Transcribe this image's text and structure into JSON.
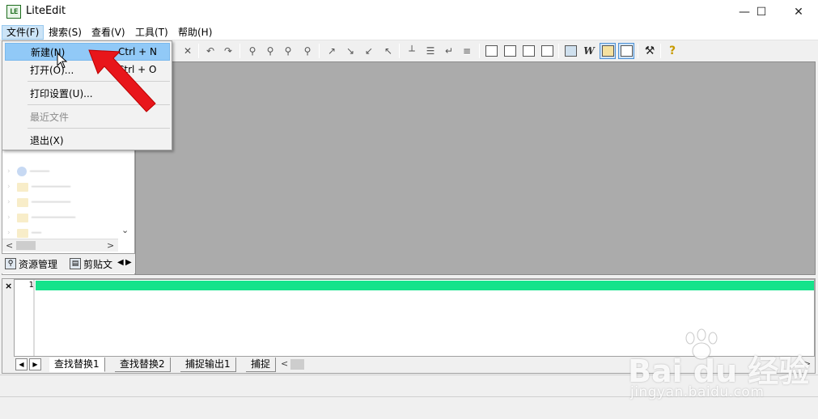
{
  "window": {
    "title": "LiteEdit",
    "icon_text": "LE",
    "controls": {
      "minimize": "—",
      "maximize": "☐",
      "close": "✕"
    }
  },
  "menubar": {
    "items": [
      {
        "label": "文件(F)"
      },
      {
        "label": "搜索(S)"
      },
      {
        "label": "查看(V)"
      },
      {
        "label": "工具(T)"
      },
      {
        "label": "帮助(H)"
      }
    ]
  },
  "file_menu": {
    "items": [
      {
        "label": "新建(N)",
        "shortcut": "Ctrl + N",
        "state": "highlighted"
      },
      {
        "label": "打开(O)...",
        "shortcut": "Ctrl + O",
        "state": "normal"
      },
      {
        "label": "打印设置(U)...",
        "shortcut": "",
        "state": "normal"
      },
      {
        "label": "最近文件",
        "shortcut": "",
        "state": "disabled"
      },
      {
        "label": "退出(X)",
        "shortcut": "",
        "state": "normal"
      }
    ]
  },
  "left_panel": {
    "tabs": [
      {
        "label": "资源管理"
      },
      {
        "label": "剪贴文"
      }
    ],
    "tab_nav": {
      "prev": "◀",
      "next": "▶"
    },
    "scroll": {
      "left": "<",
      "right": ">",
      "down": "⌄"
    }
  },
  "output_panel": {
    "close": "×",
    "line_number": "1",
    "tabs": [
      {
        "label": "查找替换1",
        "active": true
      },
      {
        "label": "查找替换2",
        "active": false
      },
      {
        "label": "捕捉输出1",
        "active": false
      },
      {
        "label": "捕捉",
        "active": false
      }
    ],
    "nav": {
      "prev": "◀",
      "next": "▶"
    },
    "scroll": {
      "left": "<",
      "right": ">"
    },
    "highlight_color": "#15e38b"
  },
  "watermark": {
    "brand": "Bai du 经验",
    "url": "jingyan.baidu.com"
  },
  "colors": {
    "menu_highlight": "#91c9f7",
    "annotation_arrow": "#e8161b",
    "mdi_background": "#ababab"
  }
}
